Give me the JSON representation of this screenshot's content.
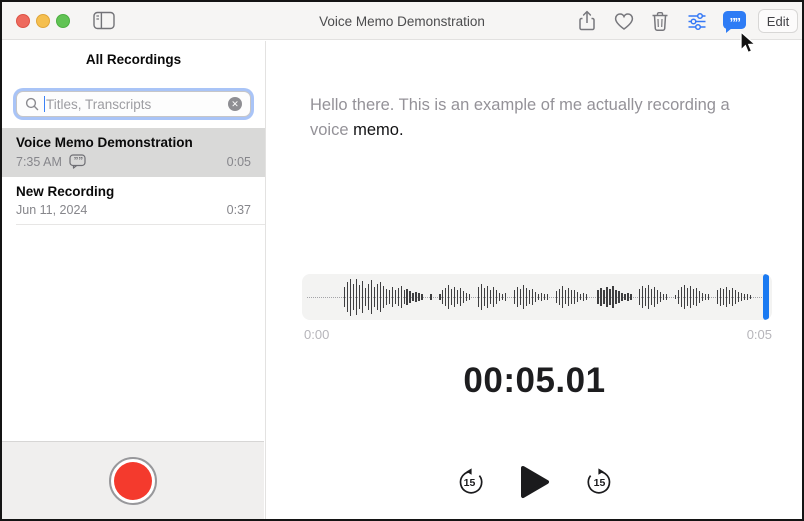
{
  "titlebar": {
    "title": "Voice Memo Demonstration",
    "edit_label": "Edit",
    "icons": [
      "sidebar-toggle-icon",
      "share-icon",
      "heart-icon",
      "trash-icon",
      "sliders-icon",
      "transcript-bubble-icon"
    ],
    "transcript_glyph": "””"
  },
  "sidebar": {
    "header": "All Recordings",
    "search": {
      "placeholder": "Titles, Transcripts",
      "clear_glyph": "✕"
    },
    "recordings": [
      {
        "title": "Voice Memo Demonstration",
        "subtitle": "7:35 AM",
        "duration": "0:05"
      },
      {
        "title": "New Recording",
        "subtitle": "Jun 11, 2024",
        "duration": "0:37"
      }
    ]
  },
  "player": {
    "transcript_gray": "Hello there. This is an example of me actually recording a voice ",
    "transcript_highlight": "memo.",
    "time_start": "0:00",
    "time_end": "0:05",
    "time_display": "00:05.01",
    "skip_seconds": "15"
  },
  "waveform": {
    "amplitudes": [
      0,
      0,
      0,
      0,
      0,
      0,
      0,
      0,
      0,
      0,
      0,
      0,
      50,
      80,
      100,
      70,
      95,
      60,
      85,
      45,
      70,
      90,
      50,
      65,
      80,
      55,
      40,
      35,
      50,
      30,
      45,
      55,
      30,
      40,
      25,
      15,
      20,
      15,
      10,
      0,
      0,
      10,
      0,
      0,
      8,
      30,
      45,
      60,
      40,
      50,
      35,
      45,
      25,
      15,
      10,
      0,
      0,
      50,
      65,
      45,
      55,
      35,
      50,
      30,
      15,
      10,
      12,
      0,
      0,
      30,
      50,
      40,
      60,
      45,
      30,
      40,
      20,
      10,
      15,
      10,
      8,
      0,
      0,
      25,
      40,
      55,
      35,
      45,
      30,
      35,
      20,
      10,
      12,
      8,
      0,
      0,
      0,
      30,
      45,
      35,
      50,
      40,
      55,
      35,
      25,
      15,
      10,
      12,
      8,
      0,
      0,
      40,
      55,
      45,
      60,
      40,
      50,
      30,
      20,
      10,
      8,
      0,
      0,
      5,
      35,
      50,
      60,
      45,
      55,
      40,
      45,
      25,
      15,
      10,
      8,
      0,
      0,
      30,
      45,
      40,
      50,
      35,
      45,
      30,
      20,
      12,
      10,
      8,
      5,
      0
    ]
  },
  "colors": {
    "accent_blue": "#2e7cf5",
    "playhead_blue": "#1a7af2",
    "record_red": "#f43a2d",
    "selected_row": "#d9d9d8"
  }
}
